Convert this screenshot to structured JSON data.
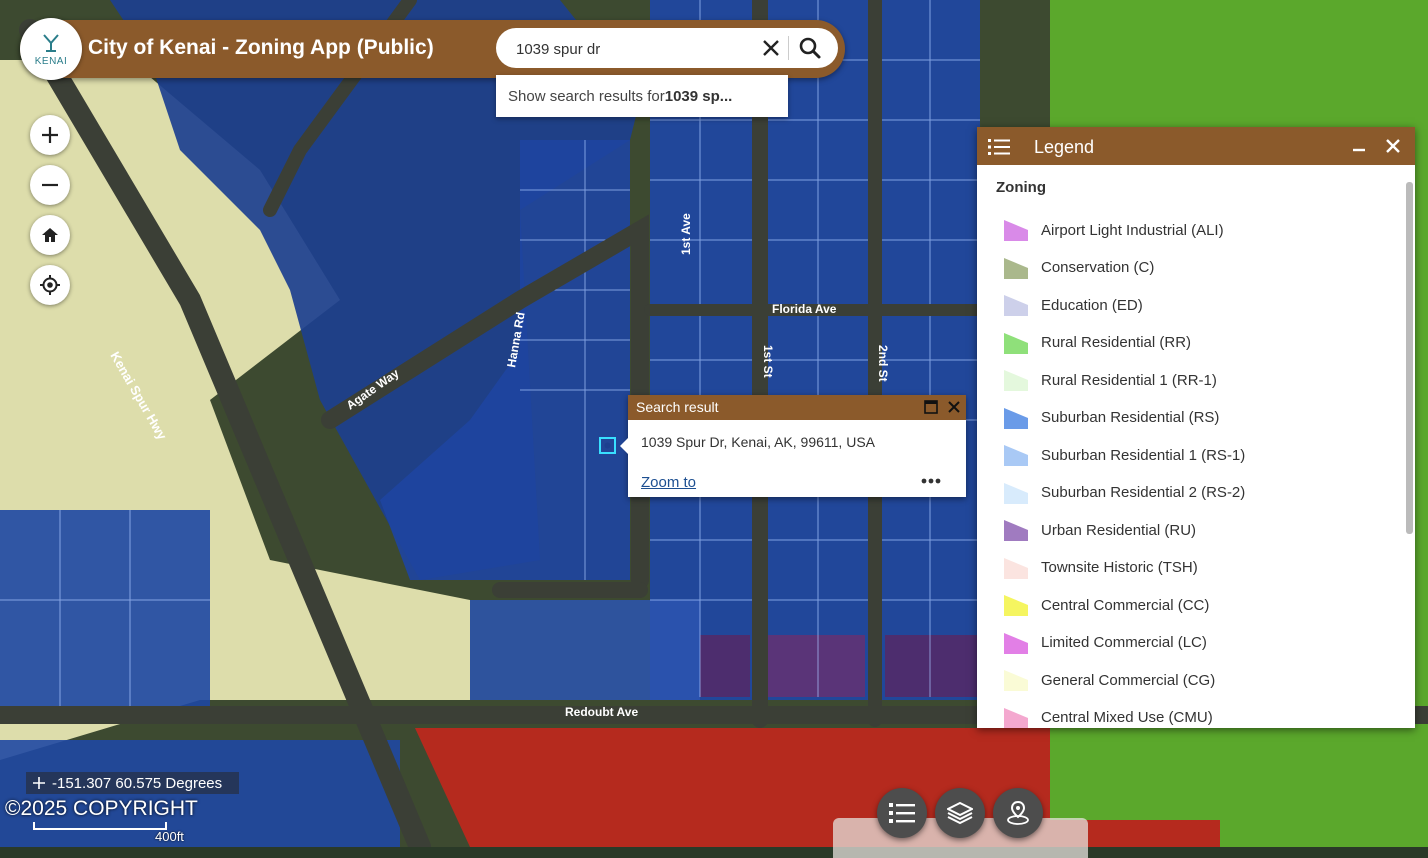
{
  "app": {
    "title": "City of Kenai - Zoning App (Public)",
    "logo_text": "KENAI"
  },
  "search": {
    "value": "1039 spur dr",
    "suggestion_prefix": "Show search results for ",
    "suggestion_term": "1039 sp..."
  },
  "map_labels": [
    {
      "text": "Kenai Spur Hwy",
      "id": "kenai-spur-hwy"
    },
    {
      "text": "Florida Ave",
      "id": "florida-ave"
    },
    {
      "text": "1st St",
      "id": "1st-st"
    },
    {
      "text": "2nd St",
      "id": "2nd-st"
    },
    {
      "text": "Redoubt Ave",
      "id": "redoubt-ave"
    },
    {
      "text": "Hanna Rd",
      "id": "hanna-rd"
    },
    {
      "text": "1st Ave",
      "id": "1st-ave"
    },
    {
      "text": "Agate Way",
      "id": "agate-way"
    }
  ],
  "popup": {
    "title": "Search result",
    "address": "1039 Spur Dr, Kenai, AK, 99611, USA",
    "zoom_label": "Zoom to"
  },
  "legend": {
    "title": "Legend",
    "group": "Zoning",
    "items": [
      {
        "label": "Airport Light Industrial (ALI)",
        "color": "#d98ae8"
      },
      {
        "label": "Conservation (C)",
        "color": "#aab88c"
      },
      {
        "label": "Education (ED)",
        "color": "#cdd0ea"
      },
      {
        "label": "Rural Residential (RR)",
        "color": "#8fe07a"
      },
      {
        "label": "Rural Residential 1 (RR-1)",
        "color": "#e4f8dd"
      },
      {
        "label": "Suburban Residential (RS)",
        "color": "#6a9be8"
      },
      {
        "label": "Suburban Residential 1 (RS-1)",
        "color": "#a9c9f5"
      },
      {
        "label": "Suburban Residential 2 (RS-2)",
        "color": "#d8ebfc"
      },
      {
        "label": "Urban Residential (RU)",
        "color": "#a07bc0"
      },
      {
        "label": "Townsite Historic (TSH)",
        "color": "#fbe4e0"
      },
      {
        "label": "Central Commercial (CC)",
        "color": "#f5f560"
      },
      {
        "label": "Limited Commercial (LC)",
        "color": "#e27fe6"
      },
      {
        "label": "General Commercial (CG)",
        "color": "#fafbd6"
      },
      {
        "label": "Central Mixed Use (CMU)",
        "color": "#f4a8cf"
      }
    ]
  },
  "status": {
    "coordinates": "-151.307 60.575 Degrees",
    "copyright": "©2025 COPYRIGHT",
    "scale": "400ft"
  },
  "colors": {
    "header": "#8b5a2b",
    "zone_rs": "#1d47a3",
    "zone_rural": "#63b52f",
    "zone_conservation": "#e6e8b8",
    "zone_commercial": "#c12d20",
    "zone_urban": "#4d2d7a"
  }
}
